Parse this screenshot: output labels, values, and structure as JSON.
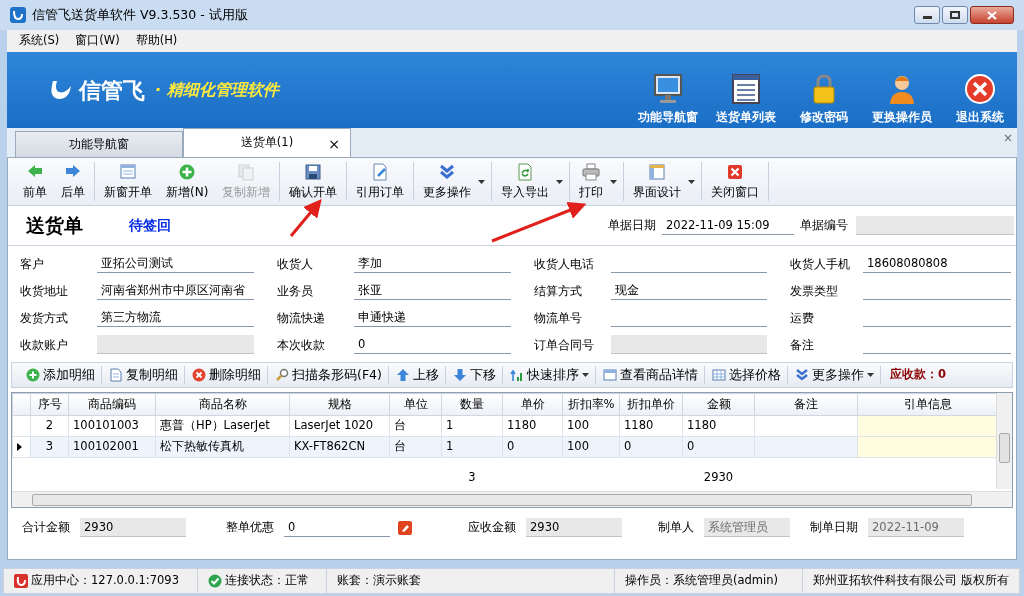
{
  "window": {
    "title": "信管飞送货单软件 V9.3.530 - 试用版"
  },
  "menu": [
    "系统(S)",
    "窗口(W)",
    "帮助(H)"
  ],
  "banner": {
    "logo_text": "信管飞",
    "slogan": "· 精细化管理软件",
    "buttons": [
      "功能导航窗",
      "送货单列表",
      "修改密码",
      "更换操作员",
      "退出系统"
    ]
  },
  "tabs": [
    {
      "label": "功能导航窗",
      "selected": false
    },
    {
      "label": "送货单(1)",
      "selected": true,
      "close": "×"
    }
  ],
  "tab_strip_close": "×",
  "toolbar": [
    [
      {
        "label": "前单",
        "disabled": false,
        "dropdown": false
      },
      {
        "label": "后单",
        "disabled": false,
        "dropdown": false
      }
    ],
    [
      {
        "label": "新窗开单",
        "disabled": false,
        "dropdown": false
      },
      {
        "label": "新增(N)",
        "disabled": false,
        "dropdown": false
      },
      {
        "label": "复制新增",
        "disabled": true,
        "dropdown": false
      }
    ],
    [
      {
        "label": "确认开单",
        "disabled": false,
        "dropdown": false
      }
    ],
    [
      {
        "label": "引用订单",
        "disabled": false,
        "dropdown": false
      }
    ],
    [
      {
        "label": "更多操作",
        "disabled": false,
        "dropdown": true
      }
    ],
    [
      {
        "label": "导入导出",
        "disabled": false,
        "dropdown": true
      }
    ],
    [
      {
        "label": "打印",
        "disabled": false,
        "dropdown": true
      }
    ],
    [
      {
        "label": "界面设计",
        "disabled": false,
        "dropdown": true
      }
    ],
    [
      {
        "label": "关闭窗口",
        "disabled": false,
        "dropdown": false
      }
    ]
  ],
  "header": {
    "title": "送货单",
    "status": "待签回",
    "date_label": "单据日期",
    "date": "2022-11-09 15:09",
    "number_label": "单据编号",
    "number_readonly": true
  },
  "fields": [
    {
      "label": "客户",
      "value": "亚拓公司测试",
      "readonly": false
    },
    {
      "label": "收货人",
      "value": "李加",
      "readonly": false
    },
    {
      "label": "收货人电话",
      "readonly": false
    },
    {
      "label": "收货人手机",
      "value": "18608080808",
      "readonly": false
    },
    {
      "label": "收货地址",
      "value": "河南省郑州市中原区河南省",
      "readonly": false
    },
    {
      "label": "业务员",
      "value": "张亚",
      "readonly": false
    },
    {
      "label": "结算方式",
      "value": "现金",
      "readonly": false
    },
    {
      "label": "发票类型",
      "readonly": false
    },
    {
      "label": "发货方式",
      "value": "第三方物流",
      "readonly": false
    },
    {
      "label": "物流快递",
      "value": "申通快递",
      "readonly": false
    },
    {
      "label": "物流单号",
      "readonly": false
    },
    {
      "label": "运费",
      "readonly": false
    },
    {
      "label": "收款账户",
      "readonly": true
    },
    {
      "label": "本次收款",
      "value": "0",
      "readonly": false
    },
    {
      "label": "订单合同号",
      "readonly": true
    },
    {
      "label": "备注",
      "readonly": false
    }
  ],
  "detail_toolbar": [
    {
      "label": "添加明细",
      "dropdown": false
    },
    {
      "label": "复制明细",
      "dropdown": false
    },
    {
      "label": "删除明细",
      "dropdown": false
    },
    {
      "label": "扫描条形码(F4)",
      "dropdown": false
    },
    {
      "label": "上移",
      "dropdown": false
    },
    {
      "label": "下移",
      "dropdown": false
    },
    {
      "label": "快速排序",
      "dropdown": true
    },
    {
      "label": "查看商品详情",
      "dropdown": false
    },
    {
      "label": "选择价格",
      "dropdown": false
    },
    {
      "label": "更多操作",
      "dropdown": true
    }
  ],
  "receivable": "应收款：0",
  "table": {
    "columns": [
      "序号",
      "商品编码",
      "商品名称",
      "规格",
      "单位",
      "数量",
      "单价",
      "折扣率%",
      "折扣单价",
      "金额",
      "备注",
      "引单信息"
    ],
    "rows": [
      {
        "cells": [
          "2",
          "100101003",
          "惠普（HP）LaserJet",
          "LaserJet 1020",
          "台",
          "1",
          "1180",
          "100",
          "1180",
          "1180",
          null,
          null
        ],
        "selected": false
      },
      {
        "cells": [
          "3",
          "100102001",
          "松下热敏传真机",
          "KX-FT862CN",
          "台",
          "1",
          "0",
          "100",
          "0",
          "0",
          null,
          null
        ],
        "selected": true
      }
    ],
    "footer": {
      "quantity_total": "3",
      "amount_total": "2930"
    }
  },
  "totals": [
    {
      "label": "合计金额",
      "value": "2930",
      "readonly": true
    },
    {
      "label": "整单优惠",
      "value": "0",
      "readonly": false,
      "button": true
    },
    {
      "label": "应收金额",
      "value": "2930",
      "readonly": true
    },
    {
      "label": "制单人",
      "value": "系统管理员",
      "readonly": true,
      "disabled": true
    },
    {
      "label": "制单日期",
      "value": "2022-11-09",
      "readonly": true,
      "disabled": true
    }
  ],
  "status_bar": [
    {
      "text": "应用中心：127.0.0.1:7093",
      "kind": "app"
    },
    {
      "text": "连接状态：正常",
      "kind": "ok"
    },
    {
      "text": "账套：演示账套",
      "kind": "plain"
    },
    {
      "text": "操作员：系统管理员(admin)",
      "kind": "plain"
    },
    {
      "text": "郑州亚拓软件科技有限公司 版权所有",
      "kind": "plain"
    }
  ]
}
